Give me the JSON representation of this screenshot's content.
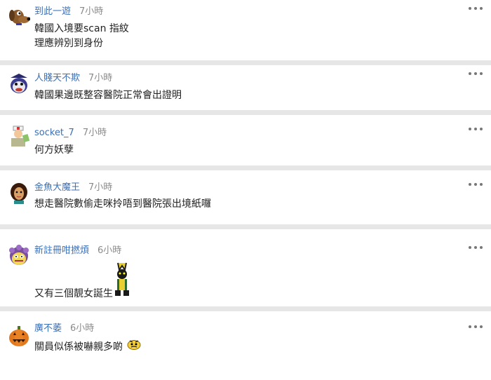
{
  "comments": [
    {
      "user": "到此一遊",
      "time": "7小時",
      "lines": [
        "韓國入境要scan 指紋",
        "理應辨別到身份"
      ],
      "avatar": "dog-avatar-icon"
    },
    {
      "user": "人賤天不欺",
      "time": "7小時",
      "lines": [
        "韓國果邊既整容醫院正常會出證明"
      ],
      "avatar": "clown-avatar-icon"
    },
    {
      "user": "socket_7",
      "time": "7小時",
      "lines": [
        "何方妖孽"
      ],
      "avatar": "doctor-avatar-icon"
    },
    {
      "user": "金魚大魔王",
      "time": "7小時",
      "lines": [
        "想走醫院數偷走咪拎唔到醫院張出境紙囉"
      ],
      "avatar": "princess-avatar-icon"
    },
    {
      "user": "新註冊咁撚煩",
      "time": "6小時",
      "lines": [
        "又有三個靚女誕生"
      ],
      "avatar": "fuzzy-monster-avatar-icon",
      "sticker": "jester-sticker-icon"
    },
    {
      "user": "廣不萎",
      "time": "6小時",
      "lines": [
        "關員似係被嚇親多啲"
      ],
      "avatar": "pumpkin-avatar-icon",
      "sticker": "scared-face-emoji-icon"
    }
  ],
  "colors": {
    "username": "#3b6fb6",
    "time": "#8a8a8a",
    "separator": "#e6e6e6"
  }
}
